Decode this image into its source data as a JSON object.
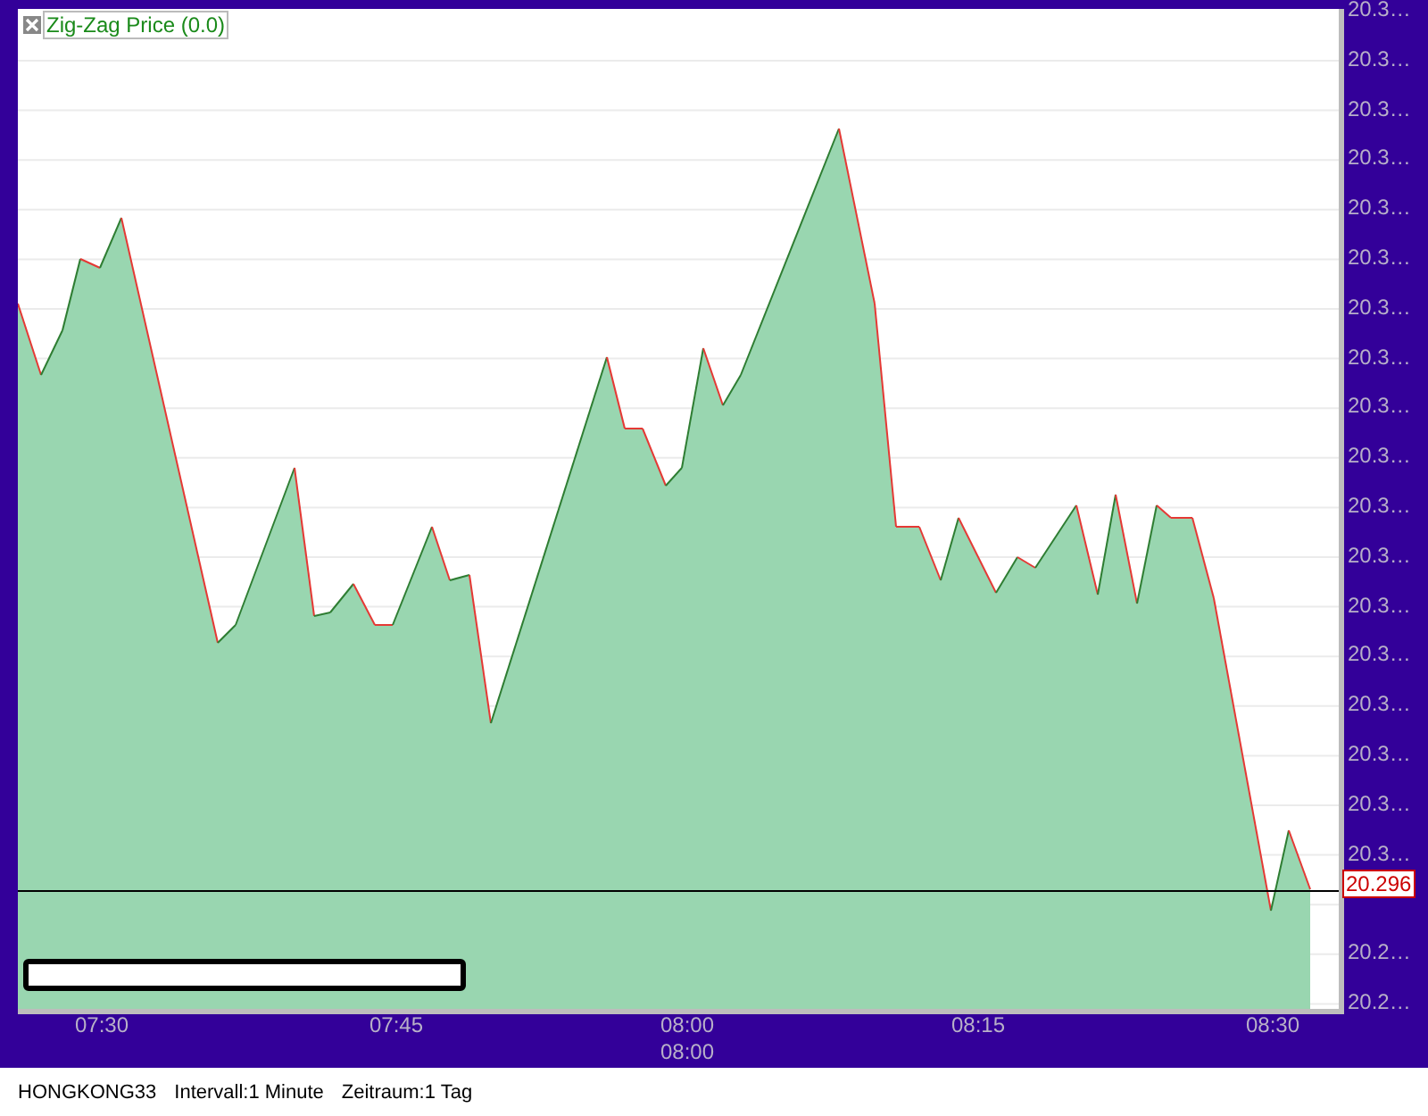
{
  "legend": {
    "label": "Zig-Zag Price (0.0)"
  },
  "y_axis": {
    "labels": [
      "20.3…",
      "20.3…",
      "20.3…",
      "20.3…",
      "20.3…",
      "20.3…",
      "20.3…",
      "20.3…",
      "20.3…",
      "20.3…",
      "20.3…",
      "20.3…",
      "20.3…",
      "20.3…",
      "20.3…",
      "20.3…",
      "20.3…",
      "20.3…",
      "20.2…",
      "20.2…"
    ]
  },
  "current_price": "20.296",
  "x_axis": {
    "ticks": [
      {
        "label": "07:30"
      },
      {
        "label": "07:45"
      },
      {
        "label": "08:00",
        "sublabel": "08:00"
      },
      {
        "label": "08:15"
      },
      {
        "label": "08:30"
      }
    ]
  },
  "status_bar": {
    "symbol": "HONGKONG33",
    "interval": "Intervall:1 Minute",
    "range": "Zeitraum:1 Tag"
  }
}
